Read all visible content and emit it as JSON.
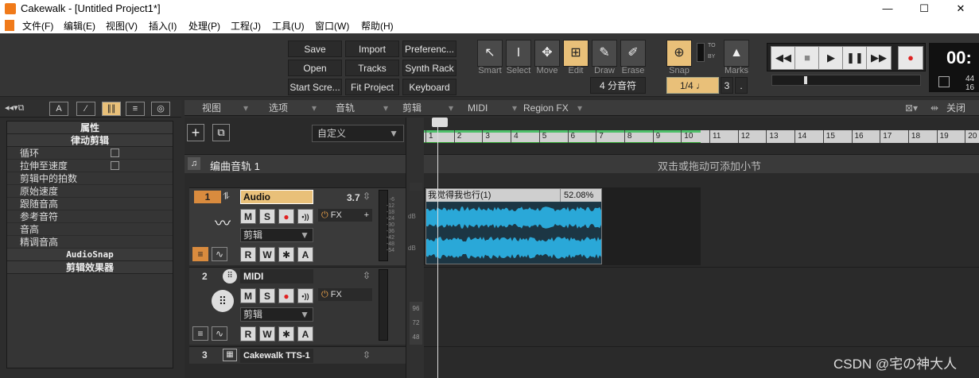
{
  "window": {
    "app_name": "Cakewalk",
    "title": "Cakewalk - [Untitled Project1*]",
    "min": "—",
    "max": "☐",
    "close": "✕"
  },
  "menu": [
    "文件(F)",
    "编辑(E)",
    "视图(V)",
    "插入(I)",
    "处理(P)",
    "工程(J)",
    "工具(U)",
    "窗口(W)",
    "帮助(H)"
  ],
  "quick_buttons": [
    "Save",
    "Import",
    "Preferenc...",
    "Open",
    "Tracks",
    "Synth Rack",
    "Start Scre...",
    "Fit Project",
    "Keyboard"
  ],
  "tools": [
    {
      "label": "Smart",
      "icon": "arrow-icon"
    },
    {
      "label": "Select",
      "icon": "ibeam-icon"
    },
    {
      "label": "Move",
      "icon": "move-icon"
    },
    {
      "label": "Edit",
      "icon": "edit-icon",
      "active": true
    },
    {
      "label": "Draw",
      "icon": "pencil-icon"
    },
    {
      "label": "Erase",
      "icon": "eraser-icon"
    }
  ],
  "snap": {
    "label": "Snap",
    "value": "1/4",
    "note": "♩",
    "num": "3",
    "dot": ".",
    "to": "TO",
    "by": "BY",
    "division": "4 分音符"
  },
  "marks_label": "Marks",
  "transport": {
    "rewind": "◀◀",
    "stop": "■",
    "play": "▶",
    "pause": "❚❚",
    "ff": "▶▶",
    "record": "●",
    "time": "00:",
    "sub": "44",
    "sub2": "16"
  },
  "inspector_tabs": [
    "A",
    "∕",
    "∥∥",
    "≡",
    "◎"
  ],
  "inspector": {
    "title": "属性",
    "section1": "律动剪辑",
    "rows": [
      "循环",
      "拉伸至速度",
      "剪辑中的拍数",
      "原始速度",
      "跟随音高",
      "参考音符",
      "音高",
      "精调音高"
    ],
    "section2": "AudioSnap",
    "section3": "剪辑效果器"
  },
  "viewbar": [
    "视图",
    "选项",
    "音轨",
    "剪辑",
    "MIDI",
    "Region FX"
  ],
  "close_label": "关闭",
  "preset": "自定义",
  "arranger": {
    "name": "编曲音轨 1",
    "hint": "双击或拖动可添加小节"
  },
  "ruler": [
    "1",
    "2",
    "3",
    "4",
    "5",
    "6",
    "7",
    "8",
    "9",
    "10",
    "11",
    "12",
    "13",
    "14",
    "15",
    "16",
    "17",
    "18",
    "19",
    "20"
  ],
  "tracks": [
    {
      "num": "1",
      "name": "Audio",
      "vol": "3.7",
      "fx": "FX",
      "mode": "剪辑",
      "buttons": [
        "M",
        "S",
        "●",
        "•))"
      ],
      "buttons2": [
        "R",
        "W",
        "✱",
        "A"
      ]
    },
    {
      "num": "2",
      "name": "MIDI",
      "fx": "FX",
      "mode": "剪辑",
      "buttons": [
        "M",
        "S",
        "●",
        "•))"
      ],
      "buttons2": [
        "R",
        "W",
        "✱",
        "A"
      ]
    },
    {
      "num": "3",
      "name": "Cakewalk TTS-1"
    }
  ],
  "meter_scale": [
    "-6",
    "-12",
    "-18",
    "-24",
    "-30",
    "-36",
    "-42",
    "-48",
    "-54"
  ],
  "meter_scale2": [
    "96",
    "72",
    "48"
  ],
  "db": "dB",
  "clip": {
    "name": "我觉得我也行(1)",
    "percent": "52.08%"
  },
  "watermark": "CSDN @宅の神大人"
}
